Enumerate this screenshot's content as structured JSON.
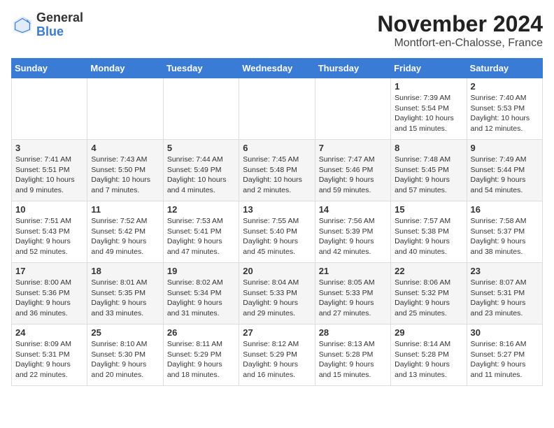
{
  "logo": {
    "general": "General",
    "blue": "Blue"
  },
  "header": {
    "month": "November 2024",
    "location": "Montfort-en-Chalosse, France"
  },
  "weekdays": [
    "Sunday",
    "Monday",
    "Tuesday",
    "Wednesday",
    "Thursday",
    "Friday",
    "Saturday"
  ],
  "weeks": [
    [
      {
        "day": "",
        "sunrise": "",
        "sunset": "",
        "daylight": ""
      },
      {
        "day": "",
        "sunrise": "",
        "sunset": "",
        "daylight": ""
      },
      {
        "day": "",
        "sunrise": "",
        "sunset": "",
        "daylight": ""
      },
      {
        "day": "",
        "sunrise": "",
        "sunset": "",
        "daylight": ""
      },
      {
        "day": "",
        "sunrise": "",
        "sunset": "",
        "daylight": ""
      },
      {
        "day": "1",
        "sunrise": "Sunrise: 7:39 AM",
        "sunset": "Sunset: 5:54 PM",
        "daylight": "Daylight: 10 hours and 15 minutes."
      },
      {
        "day": "2",
        "sunrise": "Sunrise: 7:40 AM",
        "sunset": "Sunset: 5:53 PM",
        "daylight": "Daylight: 10 hours and 12 minutes."
      }
    ],
    [
      {
        "day": "3",
        "sunrise": "Sunrise: 7:41 AM",
        "sunset": "Sunset: 5:51 PM",
        "daylight": "Daylight: 10 hours and 9 minutes."
      },
      {
        "day": "4",
        "sunrise": "Sunrise: 7:43 AM",
        "sunset": "Sunset: 5:50 PM",
        "daylight": "Daylight: 10 hours and 7 minutes."
      },
      {
        "day": "5",
        "sunrise": "Sunrise: 7:44 AM",
        "sunset": "Sunset: 5:49 PM",
        "daylight": "Daylight: 10 hours and 4 minutes."
      },
      {
        "day": "6",
        "sunrise": "Sunrise: 7:45 AM",
        "sunset": "Sunset: 5:48 PM",
        "daylight": "Daylight: 10 hours and 2 minutes."
      },
      {
        "day": "7",
        "sunrise": "Sunrise: 7:47 AM",
        "sunset": "Sunset: 5:46 PM",
        "daylight": "Daylight: 9 hours and 59 minutes."
      },
      {
        "day": "8",
        "sunrise": "Sunrise: 7:48 AM",
        "sunset": "Sunset: 5:45 PM",
        "daylight": "Daylight: 9 hours and 57 minutes."
      },
      {
        "day": "9",
        "sunrise": "Sunrise: 7:49 AM",
        "sunset": "Sunset: 5:44 PM",
        "daylight": "Daylight: 9 hours and 54 minutes."
      }
    ],
    [
      {
        "day": "10",
        "sunrise": "Sunrise: 7:51 AM",
        "sunset": "Sunset: 5:43 PM",
        "daylight": "Daylight: 9 hours and 52 minutes."
      },
      {
        "day": "11",
        "sunrise": "Sunrise: 7:52 AM",
        "sunset": "Sunset: 5:42 PM",
        "daylight": "Daylight: 9 hours and 49 minutes."
      },
      {
        "day": "12",
        "sunrise": "Sunrise: 7:53 AM",
        "sunset": "Sunset: 5:41 PM",
        "daylight": "Daylight: 9 hours and 47 minutes."
      },
      {
        "day": "13",
        "sunrise": "Sunrise: 7:55 AM",
        "sunset": "Sunset: 5:40 PM",
        "daylight": "Daylight: 9 hours and 45 minutes."
      },
      {
        "day": "14",
        "sunrise": "Sunrise: 7:56 AM",
        "sunset": "Sunset: 5:39 PM",
        "daylight": "Daylight: 9 hours and 42 minutes."
      },
      {
        "day": "15",
        "sunrise": "Sunrise: 7:57 AM",
        "sunset": "Sunset: 5:38 PM",
        "daylight": "Daylight: 9 hours and 40 minutes."
      },
      {
        "day": "16",
        "sunrise": "Sunrise: 7:58 AM",
        "sunset": "Sunset: 5:37 PM",
        "daylight": "Daylight: 9 hours and 38 minutes."
      }
    ],
    [
      {
        "day": "17",
        "sunrise": "Sunrise: 8:00 AM",
        "sunset": "Sunset: 5:36 PM",
        "daylight": "Daylight: 9 hours and 36 minutes."
      },
      {
        "day": "18",
        "sunrise": "Sunrise: 8:01 AM",
        "sunset": "Sunset: 5:35 PM",
        "daylight": "Daylight: 9 hours and 33 minutes."
      },
      {
        "day": "19",
        "sunrise": "Sunrise: 8:02 AM",
        "sunset": "Sunset: 5:34 PM",
        "daylight": "Daylight: 9 hours and 31 minutes."
      },
      {
        "day": "20",
        "sunrise": "Sunrise: 8:04 AM",
        "sunset": "Sunset: 5:33 PM",
        "daylight": "Daylight: 9 hours and 29 minutes."
      },
      {
        "day": "21",
        "sunrise": "Sunrise: 8:05 AM",
        "sunset": "Sunset: 5:33 PM",
        "daylight": "Daylight: 9 hours and 27 minutes."
      },
      {
        "day": "22",
        "sunrise": "Sunrise: 8:06 AM",
        "sunset": "Sunset: 5:32 PM",
        "daylight": "Daylight: 9 hours and 25 minutes."
      },
      {
        "day": "23",
        "sunrise": "Sunrise: 8:07 AM",
        "sunset": "Sunset: 5:31 PM",
        "daylight": "Daylight: 9 hours and 23 minutes."
      }
    ],
    [
      {
        "day": "24",
        "sunrise": "Sunrise: 8:09 AM",
        "sunset": "Sunset: 5:31 PM",
        "daylight": "Daylight: 9 hours and 22 minutes."
      },
      {
        "day": "25",
        "sunrise": "Sunrise: 8:10 AM",
        "sunset": "Sunset: 5:30 PM",
        "daylight": "Daylight: 9 hours and 20 minutes."
      },
      {
        "day": "26",
        "sunrise": "Sunrise: 8:11 AM",
        "sunset": "Sunset: 5:29 PM",
        "daylight": "Daylight: 9 hours and 18 minutes."
      },
      {
        "day": "27",
        "sunrise": "Sunrise: 8:12 AM",
        "sunset": "Sunset: 5:29 PM",
        "daylight": "Daylight: 9 hours and 16 minutes."
      },
      {
        "day": "28",
        "sunrise": "Sunrise: 8:13 AM",
        "sunset": "Sunset: 5:28 PM",
        "daylight": "Daylight: 9 hours and 15 minutes."
      },
      {
        "day": "29",
        "sunrise": "Sunrise: 8:14 AM",
        "sunset": "Sunset: 5:28 PM",
        "daylight": "Daylight: 9 hours and 13 minutes."
      },
      {
        "day": "30",
        "sunrise": "Sunrise: 8:16 AM",
        "sunset": "Sunset: 5:27 PM",
        "daylight": "Daylight: 9 hours and 11 minutes."
      }
    ]
  ]
}
